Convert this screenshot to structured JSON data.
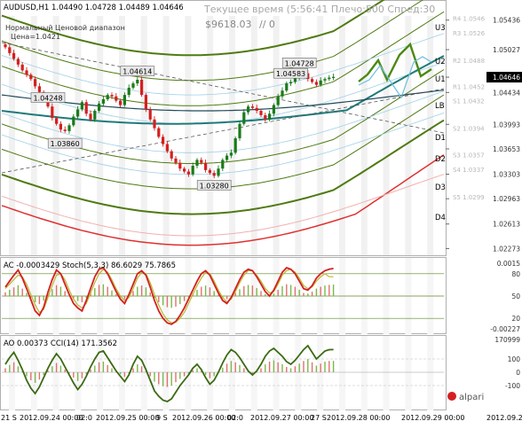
{
  "window": {
    "symbol_tf": "AUDUSD,H1",
    "ohlc": "1.04490 1.04728 1.04489 1.04646",
    "info_overlay": "Текущее время (5:56:41 Плечо:500 Спред:30",
    "overlay_line1": "Нормальный Ценовой диапазон",
    "overlay_line2": "Цена=1.0421",
    "overlay_balance": "$9618.03",
    "overlay_pct": "// 0",
    "brand": "alpari"
  },
  "colors": {
    "background": "#ffffff",
    "candle_bull": "#1a7a1a",
    "candle_bear": "#d42020",
    "price_label_bg": "#e8e8e8",
    "level_lines": "#4f7a12",
    "red_band": "#e03030",
    "teal_ma": "#1f7a7a",
    "forecast": "#4a8a12",
    "forecast_alt": "#6cc0e0",
    "ac_line": "#d42020",
    "stoch_line": "#b8b830",
    "cci_line": "#3a6a12"
  },
  "chart_data": [
    {
      "type": "candlestick",
      "title": "AUDUSD,H1",
      "x_tick_labels": [
        "21 S",
        "2012.09.24 00:00",
        "02:0",
        "2012.09.25 00:00",
        "9 S",
        "2012.09.26 00:00",
        "02:0",
        "2012.09.27 00:00",
        "27 S",
        "2012.09.28 00:00",
        "2012.09.29 00:00",
        "2012.09.29 16:00"
      ],
      "y_tick_labels": [
        "1.05436",
        "1.05027",
        "1.04646",
        "1.04434",
        "1.03993",
        "1.03653",
        "1.03303",
        "1.02963",
        "1.02613",
        "1.02273"
      ],
      "ylim": [
        1.0218,
        1.0569
      ],
      "current_price": 1.04646,
      "price_labels": [
        {
          "text": "1.04614",
          "value": 1.04614
        },
        {
          "text": "1.03860",
          "value": 1.0386
        },
        {
          "text": "1.03280",
          "value": 1.0328
        },
        {
          "text": "1.04248",
          "value": 1.04248
        },
        {
          "text": "1.04583",
          "value": 1.04583
        },
        {
          "text": "1.04728",
          "value": 1.04728
        }
      ],
      "level_labels_right": [
        "U3",
        "U2",
        "U1",
        "LB",
        "D1",
        "D2",
        "D3",
        "D4"
      ],
      "pivot_labels": [
        {
          "text": "R4 1.0546",
          "value": 1.0546
        },
        {
          "text": "R3 1.0526",
          "value": 1.0526
        },
        {
          "text": "R2 1.0488",
          "value": 1.0488
        },
        {
          "text": "R1 1.0452",
          "value": 1.0452
        },
        {
          "text": "S1 1.0432",
          "value": 1.0432
        },
        {
          "text": "S2 1.0394",
          "value": 1.0394
        },
        {
          "text": "S3 1.0357",
          "value": 1.0357
        },
        {
          "text": "S4 1.0337",
          "value": 1.0337
        },
        {
          "text": "S5 1.0299",
          "value": 1.0299
        }
      ],
      "close_series": [
        1.0506,
        1.0498,
        1.049,
        1.0482,
        1.0474,
        1.0468,
        1.0462,
        1.0452,
        1.0444,
        1.0436,
        1.0424,
        1.0408,
        1.04,
        1.0392,
        1.039,
        1.0398,
        1.041,
        1.042,
        1.043,
        1.0414,
        1.0406,
        1.0418,
        1.0428,
        1.0434,
        1.044,
        1.0438,
        1.0432,
        1.0426,
        1.044,
        1.045,
        1.0456,
        1.0461,
        1.044,
        1.042,
        1.0406,
        1.0394,
        1.0382,
        1.0372,
        1.0362,
        1.0352,
        1.0346,
        1.0338,
        1.0334,
        1.033,
        1.0342,
        1.035,
        1.0346,
        1.0336,
        1.0332,
        1.0328,
        1.0338,
        1.035,
        1.0356,
        1.036,
        1.038,
        1.04,
        1.0416,
        1.0424,
        1.0422,
        1.0418,
        1.0412,
        1.0406,
        1.0414,
        1.0426,
        1.0438,
        1.0446,
        1.0456,
        1.0458,
        1.0464,
        1.0472,
        1.047,
        1.0462,
        1.0458,
        1.0454,
        1.046,
        1.0462,
        1.0464,
        1.0465
      ]
    },
    {
      "type": "line",
      "title": "AC -0.0003429 Stoch(5,3,3) 86.6029 75.7865",
      "y_tick_labels": [
        "0.0015",
        "80",
        "50",
        "20",
        "-0.00227"
      ],
      "stoch_levels": [
        80,
        50,
        20
      ],
      "stoch_main": [
        62,
        70,
        78,
        85,
        74,
        60,
        45,
        30,
        24,
        35,
        55,
        72,
        85,
        80,
        66,
        52,
        40,
        34,
        30,
        44,
        60,
        76,
        86,
        88,
        80,
        68,
        56,
        46,
        40,
        52,
        66,
        80,
        84,
        78,
        62,
        44,
        30,
        20,
        14,
        12,
        16,
        24,
        34,
        46,
        58,
        70,
        80,
        84,
        78,
        66,
        54,
        44,
        40,
        48,
        60,
        72,
        82,
        86,
        84,
        76,
        66,
        56,
        50,
        58,
        70,
        82,
        88,
        86,
        80,
        70,
        60,
        58,
        64,
        74,
        80,
        84,
        86,
        87
      ],
      "stoch_signal": [
        60,
        66,
        72,
        78,
        76,
        66,
        52,
        38,
        28,
        32,
        48,
        64,
        78,
        80,
        72,
        58,
        46,
        38,
        34,
        40,
        54,
        68,
        80,
        86,
        82,
        72,
        60,
        50,
        44,
        48,
        60,
        74,
        82,
        80,
        68,
        52,
        38,
        26,
        18,
        14,
        15,
        20,
        28,
        40,
        52,
        64,
        74,
        82,
        80,
        70,
        58,
        48,
        42,
        46,
        56,
        68,
        78,
        84,
        84,
        78,
        70,
        60,
        54,
        56,
        66,
        78,
        84,
        86,
        82,
        74,
        64,
        60,
        62,
        70,
        76,
        80,
        76,
        76
      ]
    },
    {
      "type": "line",
      "title": "AO 0.00373 CCI(14) 171.3562",
      "y_tick_labels": [
        "170999",
        "100",
        "0",
        "-100"
      ],
      "cci_levels": [
        100,
        0,
        -100
      ],
      "cci_values": [
        60,
        110,
        150,
        90,
        20,
        -60,
        -120,
        -160,
        -110,
        -40,
        30,
        90,
        140,
        100,
        40,
        -20,
        -80,
        -130,
        -90,
        -30,
        40,
        100,
        150,
        160,
        110,
        60,
        10,
        -30,
        -70,
        -20,
        60,
        120,
        90,
        20,
        -60,
        -140,
        -180,
        -210,
        -220,
        -200,
        -150,
        -100,
        -60,
        -20,
        30,
        60,
        20,
        -40,
        -90,
        -60,
        0,
        70,
        130,
        170,
        150,
        110,
        60,
        10,
        -20,
        10,
        60,
        120,
        160,
        180,
        150,
        120,
        80,
        60,
        90,
        130,
        170,
        200,
        150,
        100,
        130,
        160,
        170,
        171
      ]
    }
  ]
}
